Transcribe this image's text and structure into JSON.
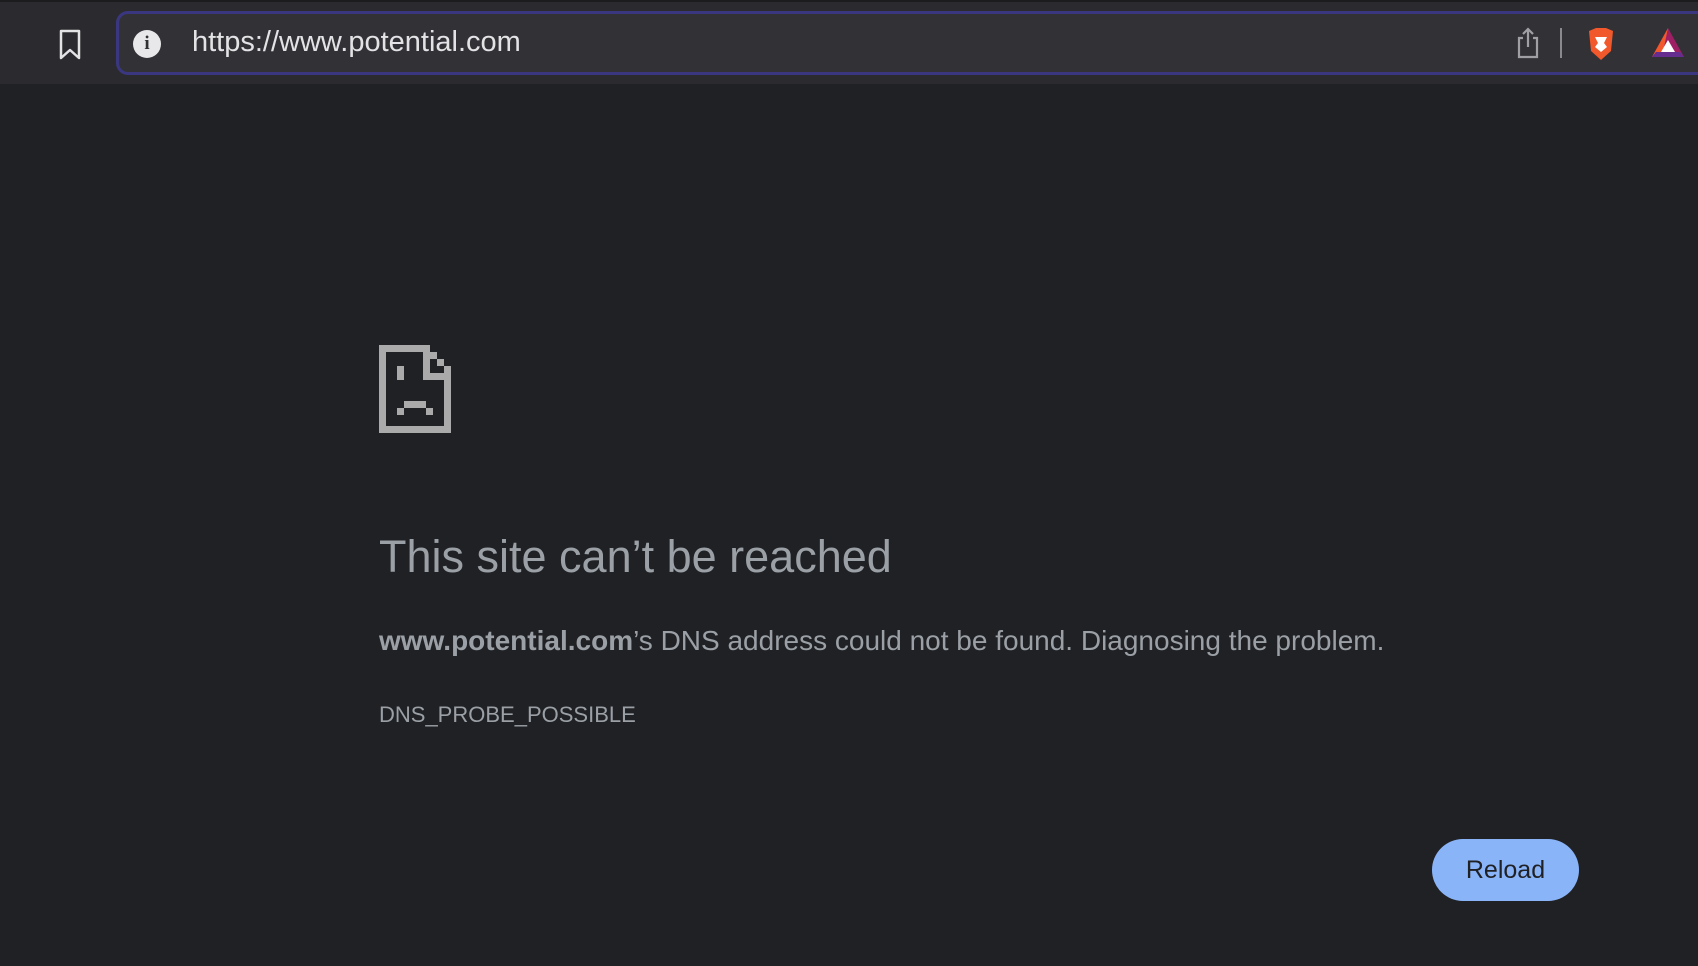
{
  "browser": {
    "url": "https://www.potential.com",
    "accent": "#3a3780"
  },
  "error": {
    "title": "This site can’t be reached",
    "host": "www.potential.com",
    "message": "’s DNS address could not be found. Diagnosing the problem.",
    "code": "DNS_PROBE_POSSIBLE",
    "reload_label": "Reload",
    "button_color": "#8ab4f8"
  }
}
